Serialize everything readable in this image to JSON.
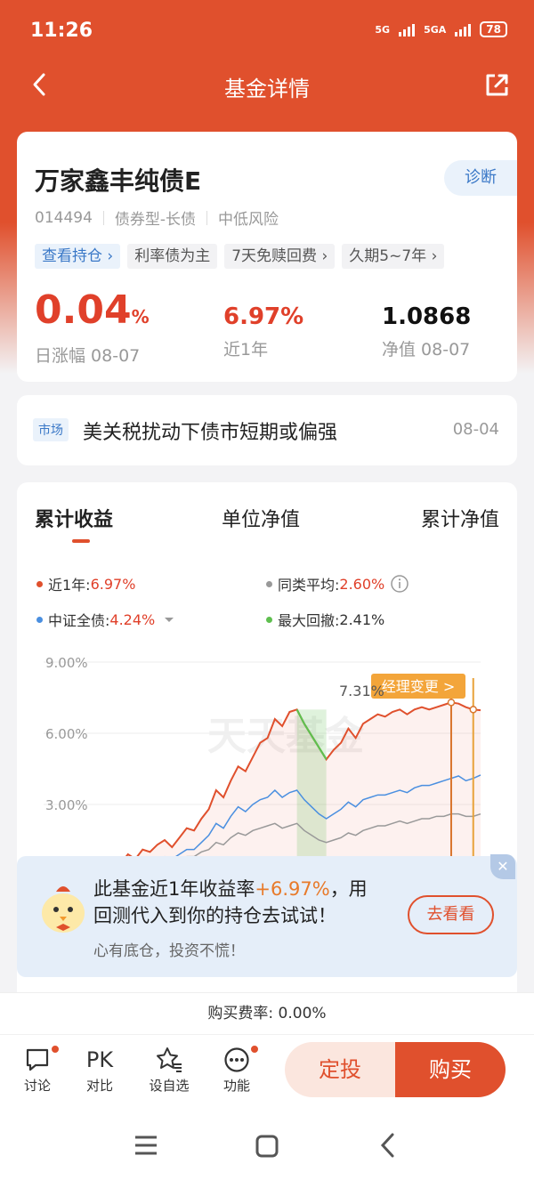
{
  "status_bar": {
    "time": "11:26",
    "net1": "5G",
    "net2": "5GA",
    "battery": "78"
  },
  "nav": {
    "title": "基金详情",
    "back_icon": "chevron-left-icon",
    "share_icon": "share-icon"
  },
  "fund": {
    "name": "万家鑫丰纯债E",
    "diagnose": "诊断",
    "code": "014494",
    "type": "债券型-长债",
    "risk": "中低风险",
    "tags": [
      "查看持仓",
      "利率债为主",
      "7天免赎回费",
      "久期5~7年"
    ],
    "daily_change": "0.04",
    "daily_unit": "%",
    "daily_label": "日涨幅 08-07",
    "year_return": "6.97%",
    "year_label": "近1年",
    "nav_value": "1.0868",
    "nav_label": "净值 08-07"
  },
  "news": {
    "badge": "市场",
    "text": "美关税扰动下债市短期或偏强",
    "date": "08-04"
  },
  "chart_tabs": [
    "累计收益",
    "单位净值",
    "累计净值"
  ],
  "legend": {
    "fund_label": "近1年:",
    "fund_value": "6.97%",
    "peer_label": "同类平均:",
    "peer_value": "2.60%",
    "index_label": "中证全债:",
    "index_value": "4.24%",
    "dd_label": "最大回撤:",
    "dd_value": "2.41%"
  },
  "chart_data": {
    "type": "line",
    "ylim": [
      0,
      9
    ],
    "ytick_labels": [
      "9.00%",
      "6.00%",
      "3.00%"
    ],
    "peak_label": "7.31%",
    "event_label": "经理变更 >",
    "watermark": "天天基金",
    "series": [
      {
        "name": "近1年",
        "color": "#e0502d",
        "values": [
          0.0,
          0.2,
          0.5,
          0.9,
          0.7,
          1.1,
          1.0,
          1.3,
          1.5,
          1.2,
          1.6,
          2.0,
          1.9,
          2.4,
          2.8,
          3.6,
          3.3,
          4.0,
          4.6,
          4.4,
          5.0,
          5.6,
          5.8,
          6.6,
          6.3,
          6.9,
          7.0,
          6.4,
          5.9,
          5.4,
          4.9,
          5.3,
          5.6,
          6.2,
          5.8,
          6.4,
          6.6,
          6.8,
          6.7,
          6.9,
          7.0,
          6.8,
          7.0,
          7.1,
          7.0,
          7.1,
          7.2,
          7.3,
          7.25,
          7.1,
          7.0,
          6.97
        ]
      },
      {
        "name": "同类平均",
        "color": "#999999",
        "values": [
          0.0,
          0.1,
          0.2,
          0.3,
          0.3,
          0.4,
          0.4,
          0.5,
          0.6,
          0.5,
          0.7,
          0.8,
          0.8,
          1.0,
          1.1,
          1.4,
          1.3,
          1.6,
          1.8,
          1.7,
          1.9,
          2.0,
          2.1,
          2.2,
          2.0,
          2.1,
          2.2,
          1.9,
          1.7,
          1.5,
          1.4,
          1.5,
          1.6,
          1.8,
          1.7,
          1.9,
          2.0,
          2.1,
          2.1,
          2.2,
          2.3,
          2.2,
          2.3,
          2.4,
          2.4,
          2.5,
          2.5,
          2.6,
          2.6,
          2.5,
          2.5,
          2.6
        ]
      },
      {
        "name": "中证全债",
        "color": "#4a8fe0",
        "values": [
          0.0,
          0.1,
          0.2,
          0.4,
          0.3,
          0.5,
          0.5,
          0.7,
          0.8,
          0.7,
          0.9,
          1.1,
          1.1,
          1.4,
          1.7,
          2.2,
          2.0,
          2.5,
          2.9,
          2.7,
          3.0,
          3.2,
          3.3,
          3.6,
          3.3,
          3.5,
          3.6,
          3.2,
          2.9,
          2.6,
          2.4,
          2.6,
          2.8,
          3.1,
          2.9,
          3.2,
          3.3,
          3.4,
          3.4,
          3.5,
          3.6,
          3.5,
          3.7,
          3.8,
          3.8,
          3.9,
          4.0,
          4.1,
          4.2,
          4.0,
          4.1,
          4.24
        ]
      },
      {
        "name": "最大回撤",
        "color": "#5fbf4f",
        "values": []
      }
    ]
  },
  "promo": {
    "line1_a": "此基金近1年收益率",
    "line1_b": "+6.97%",
    "line1_c": "，用",
    "line2": "回测代入到你的持仓去试试！",
    "sub": "心有底仓，投资不慌！",
    "button": "去看看"
  },
  "fee": "购买费率: 0.00%",
  "bottom": {
    "discuss": "讨论",
    "pk_icon": "PK",
    "compare": "对比",
    "watchlist": "设自选",
    "functions": "功能",
    "auto_invest": "定投",
    "buy": "购买"
  }
}
